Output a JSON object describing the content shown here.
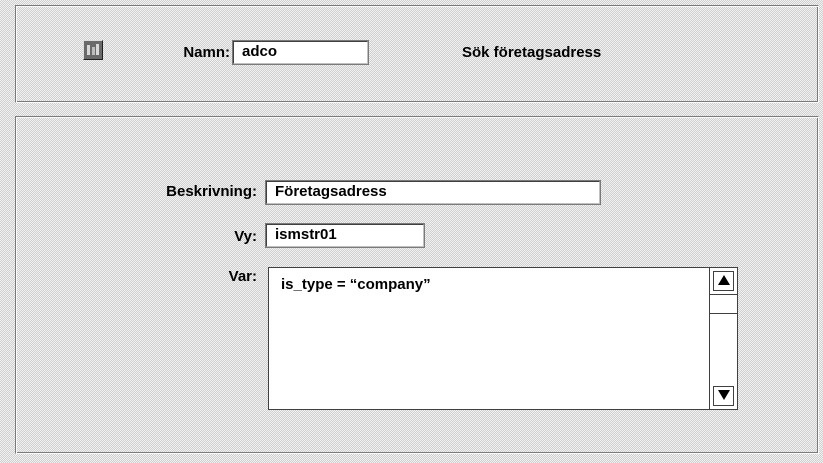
{
  "header": {
    "icon": "form-app-icon",
    "name_label": "Namn:",
    "name_value": "adco",
    "title": "Sök företagsadress"
  },
  "form": {
    "description_label": "Beskrivning:",
    "description_value": "Företagsadress",
    "view_label": "Vy:",
    "view_value": "ismstr01",
    "where_label": "Var:",
    "where_value": "is_type = “company”"
  },
  "scrollbar": {
    "up_icon": "arrow-up-icon",
    "down_icon": "arrow-down-icon"
  }
}
